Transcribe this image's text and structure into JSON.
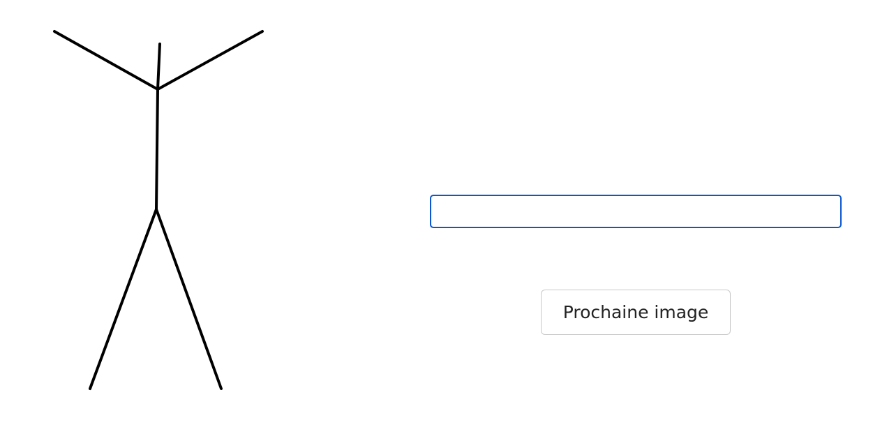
{
  "answer_field": {
    "value": "",
    "placeholder": ""
  },
  "next_button": {
    "label": "Prochaine image"
  },
  "illustration": {
    "subject": "stick-figure",
    "stroke_color": "#000000"
  },
  "colors": {
    "focus_border": "#0b57d0",
    "button_border": "#c8c8c8",
    "text": "#222222"
  }
}
